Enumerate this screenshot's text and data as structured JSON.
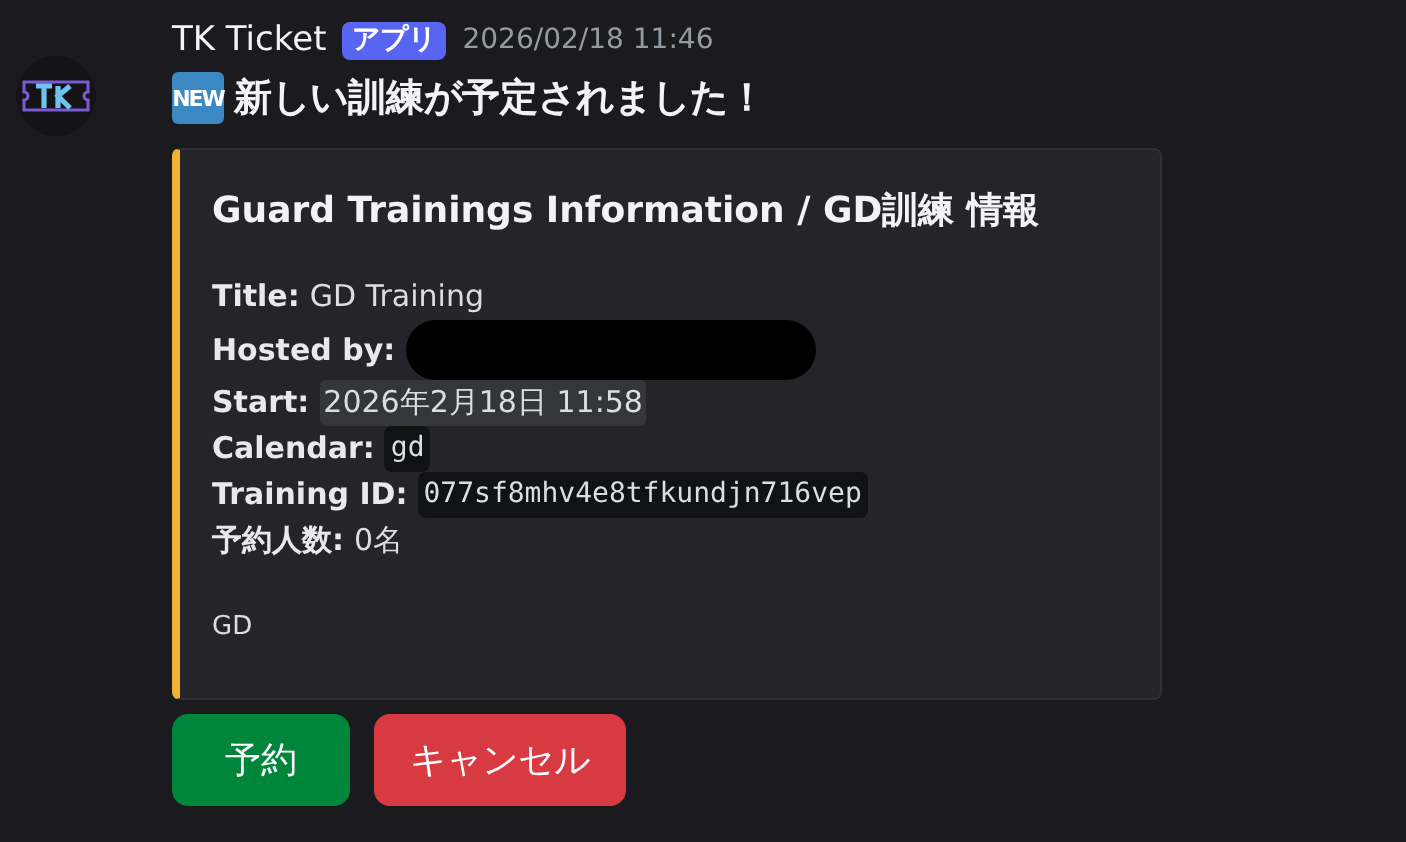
{
  "message": {
    "author": "TK Ticket",
    "badge": "アプリ",
    "timestamp": "2026/02/18 11:46",
    "new_tag": "NEW",
    "text": "新しい訓練が予定されました！"
  },
  "embed": {
    "title": "Guard Trainings Information / GD訓練 情報",
    "fields": [
      {
        "kind": "plain",
        "label": "Title:",
        "value": "GD Training"
      },
      {
        "kind": "redacted",
        "label": "Hosted by:"
      },
      {
        "kind": "timestamp",
        "label": "Start:",
        "value": "2026年2月18日 11:58"
      },
      {
        "kind": "code",
        "label": "Calendar:",
        "value": "gd"
      },
      {
        "kind": "code",
        "label": "Training ID:",
        "value": "077sf8mhv4e8tfkundjn716vep"
      },
      {
        "kind": "plain",
        "label": "予約人数:",
        "value": "0名"
      }
    ],
    "footer": "GD"
  },
  "buttons": [
    {
      "label": "予約",
      "color": "#00863a"
    },
    {
      "label": "キャンセル",
      "color": "#d83a42"
    }
  ]
}
